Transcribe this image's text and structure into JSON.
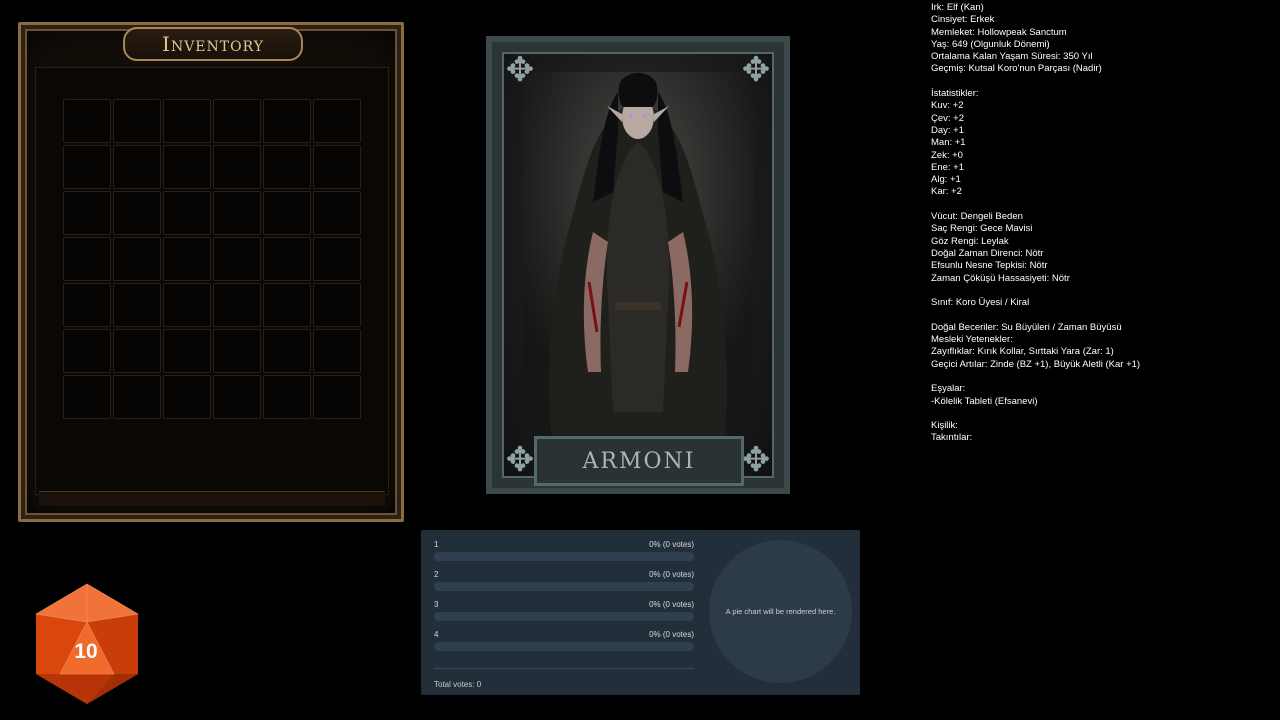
{
  "inventory": {
    "title": "Inventory",
    "rows": 7,
    "cols": 6
  },
  "character": {
    "name": "ARMONI"
  },
  "stats": {
    "lines": [
      "Irk: Elf (Kan)",
      "Cinsiyet: Erkek",
      "Memleket: Hollowpeak Sanctum",
      "Yaş: 649 (Olgunluk Dönemi)",
      "Ortalama Kalan Yaşam Süresi: 350 Yıl",
      "Geçmiş: Kutsal Koro'nun Parçası (Nadir)",
      "",
      "İstatistikler:",
      "Kuv: +2",
      "Çev: +2",
      "Day: +1",
      "Man: +1",
      "Zek: +0",
      "Ene: +1",
      "Alg: +1",
      "Kar: +2",
      "",
      "Vücut: Dengeli Beden",
      "Saç Rengi: Gece Mavisi",
      "Göz Rengi: Leylak",
      "Doğal Zaman Direnci: Nötr",
      "Efsunlu Nesne Tepkisi: Nötr",
      "Zaman Çöküşü Hassasiyeti: Nötr",
      "",
      "Sınıf: Koro Üyesi / Kiral",
      "",
      "Doğal Beceriler: Su Büyüleri / Zaman Büyüsü",
      "Mesleki Yetenekler:",
      "Zayıflıklar: Kırık Kollar, Sırttaki Yara (Zar: 1)",
      "Geçici Artılar: Zinde (BZ +1), Büyük Aletli (Kar +1)",
      "",
      "Eşyalar:",
      "-Kölelik Tableti (Efsanevi)",
      "",
      "Kişilik:",
      "Takıntılar:"
    ]
  },
  "poll": {
    "options": [
      {
        "label": "1",
        "result": "0% (0 votes)",
        "fraction": 0
      },
      {
        "label": "2",
        "result": "0% (0 votes)",
        "fraction": 0
      },
      {
        "label": "3",
        "result": "0% (0 votes)",
        "fraction": 0
      },
      {
        "label": "4",
        "result": "0% (0 votes)",
        "fraction": 0
      }
    ],
    "total": "Total votes: 0",
    "pie_placeholder": "A pie chart will be rendered here."
  },
  "dice": {
    "value": "10",
    "color": "#e8541c"
  }
}
